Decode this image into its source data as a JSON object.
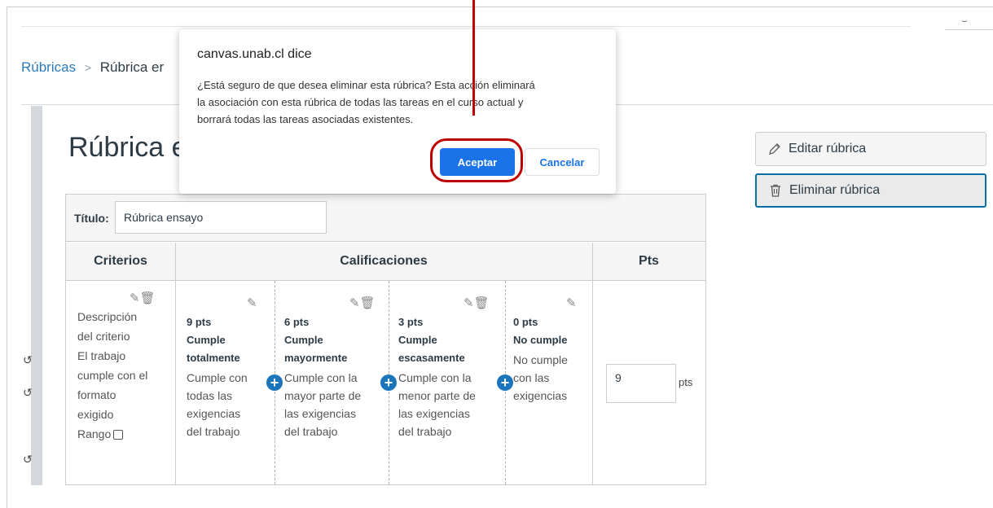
{
  "breadcrumb": {
    "item1": "Rúbricas",
    "separator": ">",
    "item2": "Rúbrica er"
  },
  "page": {
    "title": "Rúbrica e"
  },
  "actions": {
    "edit_label": "Editar rúbrica",
    "delete_label": "Eliminar rúbrica"
  },
  "rubric": {
    "title_label": "Título:",
    "title_value": "Rúbrica ensayo",
    "headers": {
      "criteria": "Criterios",
      "ratings": "Calificaciones",
      "points": "Pts"
    },
    "criterion": {
      "line1": "Descripción",
      "line2": "del criterio",
      "desc": [
        "El trabajo",
        "cumple con el",
        "formato",
        "exigido"
      ],
      "range_label": "Rango"
    },
    "ratings": [
      {
        "points": "9 pts",
        "title": [
          "Cumple",
          "totalmente"
        ],
        "description": [
          "Cumple con",
          "todas las",
          "exigencias",
          "del trabajo"
        ]
      },
      {
        "points": "6 pts",
        "title": [
          "Cumple",
          "mayormente"
        ],
        "description": [
          "Cumple con la",
          "mayor parte de",
          "las exigencias",
          "del trabajo"
        ]
      },
      {
        "points": "3 pts",
        "title": [
          "Cumple",
          "escasamente"
        ],
        "description": [
          "Cumple con la",
          "menor parte de",
          "las exigencias",
          "del trabajo"
        ]
      },
      {
        "points": "0 pts",
        "title": [
          "No cumple"
        ],
        "description": [
          "No cumple",
          "con las",
          "exigencias"
        ]
      }
    ],
    "points_value": "9",
    "points_unit": "pts"
  },
  "dialog": {
    "host": "canvas.unab.cl dice",
    "message_lines": [
      "¿Está seguro de que desea eliminar esta rúbrica? Esta acción eliminará",
      "la asociación con esta rúbrica de todas las tareas en el curso actual y",
      "borrará todas las tareas asociadas existentes."
    ],
    "ok_label": "Aceptar",
    "cancel_label": "Cancelar"
  },
  "colors": {
    "annotation": "#c00000",
    "primary_button": "#1a73e8",
    "link": "#2b7abc",
    "focus": "#0770a3"
  },
  "icons": [
    "pencil-icon",
    "trash-icon",
    "plus-circle-icon",
    "checkbox-icon"
  ]
}
